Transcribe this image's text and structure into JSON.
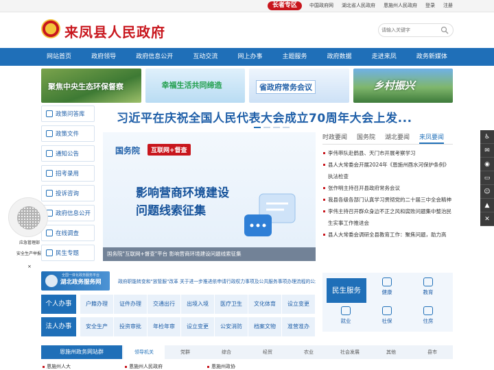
{
  "topbar": {
    "elder_label": "长者专区",
    "links": [
      "中国政府网",
      "湖北省人民政府",
      "恩施州人民政府",
      "登录",
      "注册"
    ]
  },
  "header": {
    "title": "来凤县人民政府",
    "search_placeholder": "请输入关键字"
  },
  "nav": [
    "网站首页",
    "政府领导",
    "政府信息公开",
    "互动交流",
    "网上办事",
    "主题服务",
    "政府数据",
    "走进来凤",
    "政务新媒体"
  ],
  "banners": [
    "聚焦中央生态环保督察",
    "幸福生活共同缔造",
    "省政府常务会议",
    "乡村振兴"
  ],
  "sidemenu": [
    "政策问答库",
    "政策文件",
    "通知公告",
    "招考录用",
    "投诉咨询",
    "政府信息公开",
    "在线调查",
    "民生专题"
  ],
  "headline": "习近平在庆祝全国人民代表大会成立70周年大会上发...",
  "hero": {
    "org": "国务院",
    "tag": "互联网+督查",
    "line1": "影响营商环境建设",
    "line2": "问题线索征集",
    "caption": "国务院\"互联网+督查\"平台 影响营商环境建设问题线索征集"
  },
  "news_tabs": [
    "时政要闻",
    "国务院",
    "湖北要闻",
    "来凤要闻"
  ],
  "news_active": "来凤要闻",
  "news": [
    "李伟带队赴鹤县、天门市开展考察学习",
    "县人大常委会开展2024年《恩施州酉水河保护条例》执法检查",
    "张作明主持召开县政府常务会议",
    "我县各级各部门认真学习贯彻党的二十届三中全会精神",
    "李伟主持召开群众身边不正之风和腐败问题集中整治民生实事工作推进会",
    "县人大常委会调研全县教育工作：聚焦问题，助力高"
  ],
  "float_icons": [
    "accessibility-icon",
    "wechat-icon",
    "weibo-icon",
    "app-icon",
    "chat-icon",
    "top-icon",
    "close-icon"
  ],
  "qr": {
    "label1": "应急管理部",
    "label2": "安全生产举报",
    "close": "×"
  },
  "hubei": {
    "small": "全国一体化政务服务平台",
    "title": "湖北政务服务网"
  },
  "marquee": "政府职能转变和\"放管服\"改革   关于进一步推进依申请行政权力事项及公共服务事项办理流程的公示",
  "services": {
    "personal": {
      "label": "个人办事",
      "items": [
        "户籍办理",
        "证件办理",
        "交通出行",
        "出境入境",
        "医疗卫生",
        "文化体育",
        "设立变更"
      ]
    },
    "legal": {
      "label": "法人办事",
      "items": [
        "安全生产",
        "投资审批",
        "年检年审",
        "设立变更",
        "公安消防",
        "档案文物",
        "准营准办"
      ]
    }
  },
  "life": {
    "label": "民生服务",
    "items": [
      "健康",
      "教育",
      "就业",
      "社保",
      "住房"
    ]
  },
  "bottom_tabs": {
    "header": "恩施州政务网站群",
    "items": [
      "领导机关",
      "党群",
      "综合",
      "经贸",
      "农业",
      "社会发展",
      "其他",
      "县市"
    ],
    "active": "领导机关"
  },
  "bottom_links": [
    "恩施州人大",
    "恩施州人民政府",
    "恩施州政协"
  ]
}
